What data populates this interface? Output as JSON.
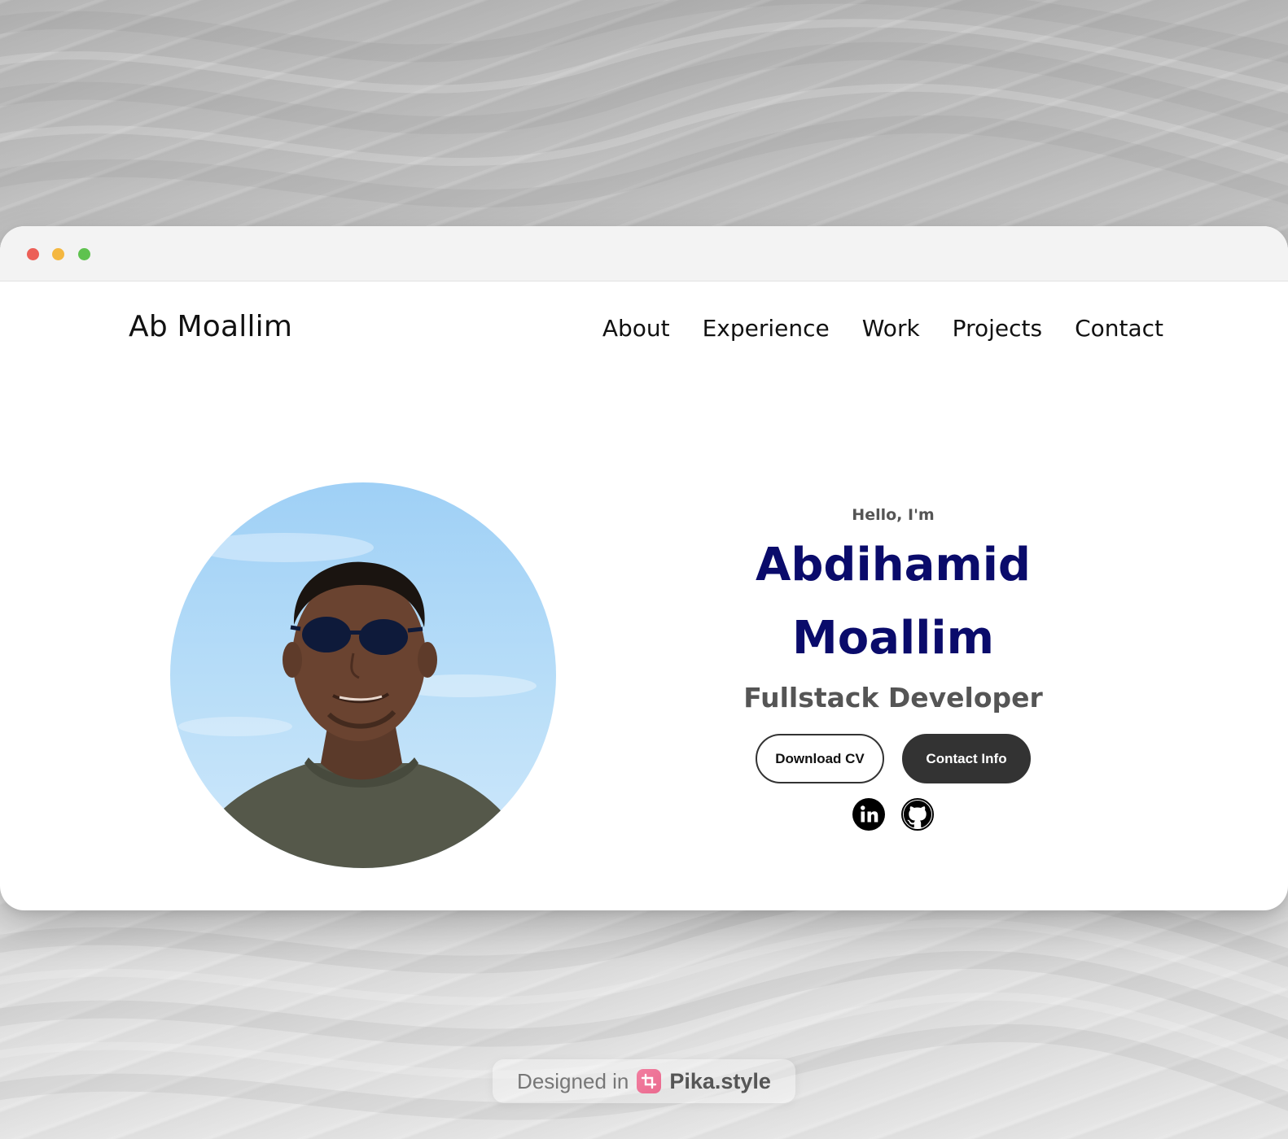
{
  "window": {
    "traffic_lights": {
      "close": "#ec5f57",
      "minimize": "#f4b740",
      "maximize": "#5fc24f"
    }
  },
  "nav": {
    "logo": "Ab Moallim",
    "links": [
      {
        "label": "About"
      },
      {
        "label": "Experience"
      },
      {
        "label": "Work"
      },
      {
        "label": "Projects"
      },
      {
        "label": "Contact"
      }
    ]
  },
  "hero": {
    "greeting": "Hello, I'm",
    "name_line1": "Abdihamid",
    "name_line2": "Moallim",
    "title": "Fullstack Developer",
    "buttons": {
      "download_cv": "Download CV",
      "contact_info": "Contact Info"
    },
    "socials": [
      {
        "icon": "linkedin-icon"
      },
      {
        "icon": "github-icon"
      }
    ],
    "name_color": "#0a0b6b"
  },
  "footer_badge": {
    "prefix": "Designed in",
    "brand": "Pika.style"
  }
}
